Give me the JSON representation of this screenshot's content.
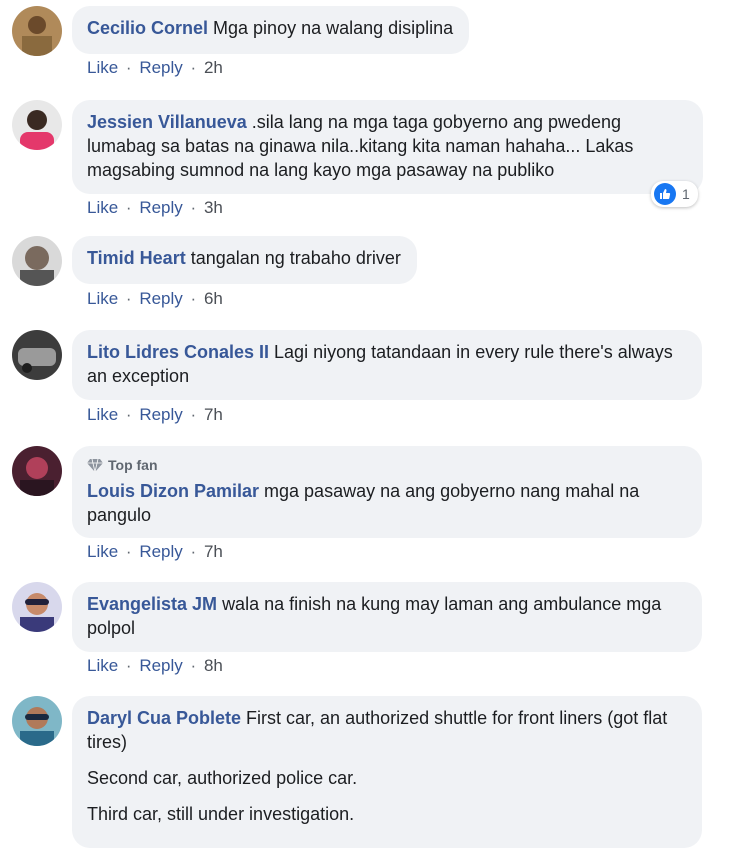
{
  "actions": {
    "like": "Like",
    "reply": "Reply",
    "sep": "·"
  },
  "comments": [
    {
      "author": "Cecilio Cornel",
      "text": "Mga pinoy na walang disiplina",
      "time": "2h"
    },
    {
      "author": "Jessien Villanueva",
      "text": ".sila lang na mga taga gobyerno ang pwedeng lumabag sa batas na ginawa nila..kitang kita naman hahaha... Lakas magsabing sumnod na lang kayo mga pasaway na publiko",
      "time": "3h",
      "reaction_count": "1"
    },
    {
      "author": "Timid Heart",
      "text": "tangalan ng trabaho driver",
      "time": "6h"
    },
    {
      "author": "Lito Lidres Conales II",
      "text": "Lagi niyong tatandaan in every rule there's always an exception",
      "time": "7h"
    },
    {
      "badge": "Top fan",
      "author": "Louis Dizon Pamilar",
      "text": "mga pasaway na ang gobyerno nang mahal na pangulo",
      "time": "7h"
    },
    {
      "author": "Evangelista JM",
      "text": "wala na finish na kung may laman ang ambulance mga polpol",
      "time": "8h"
    },
    {
      "author": "Daryl Cua Poblete",
      "text": "First car, an authorized shuttle for front liners (got flat tires)",
      "text2": "Second car, authorized police car.",
      "text3": "Third car, still under investigation."
    }
  ]
}
